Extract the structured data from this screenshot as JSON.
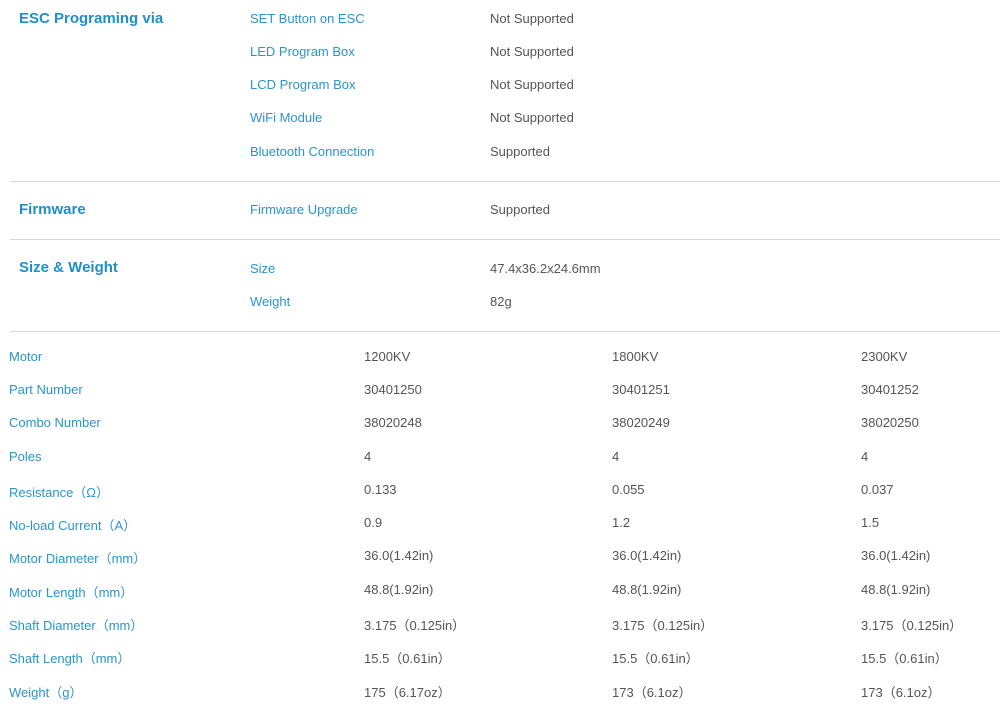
{
  "esc_section": {
    "title": "ESC Programing via",
    "rows": [
      {
        "label": "SET Button on ESC",
        "value": "Not Supported"
      },
      {
        "label": "LED Program Box",
        "value": "Not Supported"
      },
      {
        "label": "LCD Program Box",
        "value": "Not Supported"
      },
      {
        "label": "WiFi Module",
        "value": "Not Supported"
      },
      {
        "label": "Bluetooth Connection",
        "value": "Supported"
      }
    ]
  },
  "firmware_section": {
    "title": "Firmware",
    "rows": [
      {
        "label": "Firmware Upgrade",
        "value": "Supported"
      }
    ]
  },
  "size_section": {
    "title": "Size & Weight",
    "rows": [
      {
        "label": "Size",
        "value": "47.4x36.2x24.6mm"
      },
      {
        "label": "Weight",
        "value": "82g"
      }
    ]
  },
  "motor_table": {
    "rows": [
      {
        "label": "Motor",
        "values": [
          "1200KV",
          "1800KV",
          "2300KV"
        ]
      },
      {
        "label": "Part Number",
        "values": [
          "30401250",
          "30401251",
          "30401252"
        ]
      },
      {
        "label": "Combo Number",
        "values": [
          "38020248",
          "38020249",
          "38020250"
        ]
      },
      {
        "label": "Poles",
        "values": [
          "4",
          "4",
          "4"
        ]
      },
      {
        "label": "Resistance（Ω）",
        "values": [
          "0.133",
          "0.055",
          "0.037"
        ]
      },
      {
        "label": "No-load Current（A）",
        "values": [
          "0.9",
          "1.2",
          "1.5"
        ]
      },
      {
        "label": "Motor Diameter（mm）",
        "values": [
          "36.0(1.42in)",
          "36.0(1.42in)",
          "36.0(1.42in)"
        ]
      },
      {
        "label": "Motor Length（mm）",
        "values": [
          "48.8(1.92in)",
          "48.8(1.92in)",
          "48.8(1.92in)"
        ]
      },
      {
        "label": "Shaft Diameter（mm）",
        "values": [
          "3.175（0.125in）",
          "3.175（0.125in）",
          "3.175（0.125in）"
        ]
      },
      {
        "label": "Shaft Length（mm）",
        "values": [
          "15.5（0.61in）",
          "15.5（0.61in）",
          "15.5（0.61in）"
        ]
      },
      {
        "label": "Weight（g）",
        "values": [
          "175（6.17oz）",
          "173（6.1oz）",
          "173（6.1oz）"
        ]
      }
    ]
  }
}
